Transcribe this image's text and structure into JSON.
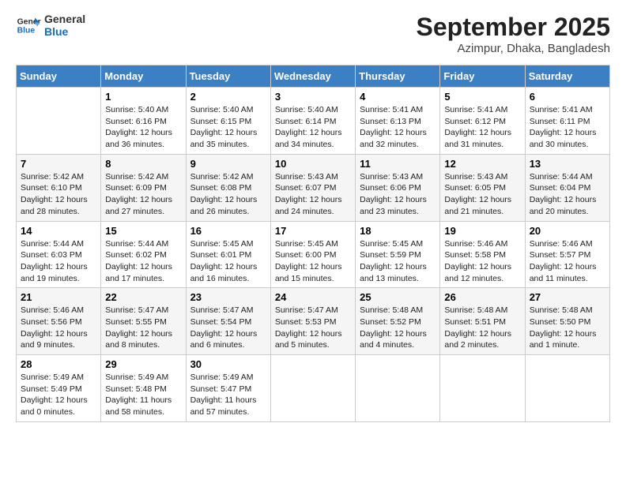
{
  "header": {
    "logo_line1": "General",
    "logo_line2": "Blue",
    "month": "September 2025",
    "location": "Azimpur, Dhaka, Bangladesh"
  },
  "weekdays": [
    "Sunday",
    "Monday",
    "Tuesday",
    "Wednesday",
    "Thursday",
    "Friday",
    "Saturday"
  ],
  "weeks": [
    [
      {
        "day": "",
        "info": ""
      },
      {
        "day": "1",
        "info": "Sunrise: 5:40 AM\nSunset: 6:16 PM\nDaylight: 12 hours\nand 36 minutes."
      },
      {
        "day": "2",
        "info": "Sunrise: 5:40 AM\nSunset: 6:15 PM\nDaylight: 12 hours\nand 35 minutes."
      },
      {
        "day": "3",
        "info": "Sunrise: 5:40 AM\nSunset: 6:14 PM\nDaylight: 12 hours\nand 34 minutes."
      },
      {
        "day": "4",
        "info": "Sunrise: 5:41 AM\nSunset: 6:13 PM\nDaylight: 12 hours\nand 32 minutes."
      },
      {
        "day": "5",
        "info": "Sunrise: 5:41 AM\nSunset: 6:12 PM\nDaylight: 12 hours\nand 31 minutes."
      },
      {
        "day": "6",
        "info": "Sunrise: 5:41 AM\nSunset: 6:11 PM\nDaylight: 12 hours\nand 30 minutes."
      }
    ],
    [
      {
        "day": "7",
        "info": "Sunrise: 5:42 AM\nSunset: 6:10 PM\nDaylight: 12 hours\nand 28 minutes."
      },
      {
        "day": "8",
        "info": "Sunrise: 5:42 AM\nSunset: 6:09 PM\nDaylight: 12 hours\nand 27 minutes."
      },
      {
        "day": "9",
        "info": "Sunrise: 5:42 AM\nSunset: 6:08 PM\nDaylight: 12 hours\nand 26 minutes."
      },
      {
        "day": "10",
        "info": "Sunrise: 5:43 AM\nSunset: 6:07 PM\nDaylight: 12 hours\nand 24 minutes."
      },
      {
        "day": "11",
        "info": "Sunrise: 5:43 AM\nSunset: 6:06 PM\nDaylight: 12 hours\nand 23 minutes."
      },
      {
        "day": "12",
        "info": "Sunrise: 5:43 AM\nSunset: 6:05 PM\nDaylight: 12 hours\nand 21 minutes."
      },
      {
        "day": "13",
        "info": "Sunrise: 5:44 AM\nSunset: 6:04 PM\nDaylight: 12 hours\nand 20 minutes."
      }
    ],
    [
      {
        "day": "14",
        "info": "Sunrise: 5:44 AM\nSunset: 6:03 PM\nDaylight: 12 hours\nand 19 minutes."
      },
      {
        "day": "15",
        "info": "Sunrise: 5:44 AM\nSunset: 6:02 PM\nDaylight: 12 hours\nand 17 minutes."
      },
      {
        "day": "16",
        "info": "Sunrise: 5:45 AM\nSunset: 6:01 PM\nDaylight: 12 hours\nand 16 minutes."
      },
      {
        "day": "17",
        "info": "Sunrise: 5:45 AM\nSunset: 6:00 PM\nDaylight: 12 hours\nand 15 minutes."
      },
      {
        "day": "18",
        "info": "Sunrise: 5:45 AM\nSunset: 5:59 PM\nDaylight: 12 hours\nand 13 minutes."
      },
      {
        "day": "19",
        "info": "Sunrise: 5:46 AM\nSunset: 5:58 PM\nDaylight: 12 hours\nand 12 minutes."
      },
      {
        "day": "20",
        "info": "Sunrise: 5:46 AM\nSunset: 5:57 PM\nDaylight: 12 hours\nand 11 minutes."
      }
    ],
    [
      {
        "day": "21",
        "info": "Sunrise: 5:46 AM\nSunset: 5:56 PM\nDaylight: 12 hours\nand 9 minutes."
      },
      {
        "day": "22",
        "info": "Sunrise: 5:47 AM\nSunset: 5:55 PM\nDaylight: 12 hours\nand 8 minutes."
      },
      {
        "day": "23",
        "info": "Sunrise: 5:47 AM\nSunset: 5:54 PM\nDaylight: 12 hours\nand 6 minutes."
      },
      {
        "day": "24",
        "info": "Sunrise: 5:47 AM\nSunset: 5:53 PM\nDaylight: 12 hours\nand 5 minutes."
      },
      {
        "day": "25",
        "info": "Sunrise: 5:48 AM\nSunset: 5:52 PM\nDaylight: 12 hours\nand 4 minutes."
      },
      {
        "day": "26",
        "info": "Sunrise: 5:48 AM\nSunset: 5:51 PM\nDaylight: 12 hours\nand 2 minutes."
      },
      {
        "day": "27",
        "info": "Sunrise: 5:48 AM\nSunset: 5:50 PM\nDaylight: 12 hours\nand 1 minute."
      }
    ],
    [
      {
        "day": "28",
        "info": "Sunrise: 5:49 AM\nSunset: 5:49 PM\nDaylight: 12 hours\nand 0 minutes."
      },
      {
        "day": "29",
        "info": "Sunrise: 5:49 AM\nSunset: 5:48 PM\nDaylight: 11 hours\nand 58 minutes."
      },
      {
        "day": "30",
        "info": "Sunrise: 5:49 AM\nSunset: 5:47 PM\nDaylight: 11 hours\nand 57 minutes."
      },
      {
        "day": "",
        "info": ""
      },
      {
        "day": "",
        "info": ""
      },
      {
        "day": "",
        "info": ""
      },
      {
        "day": "",
        "info": ""
      }
    ]
  ]
}
